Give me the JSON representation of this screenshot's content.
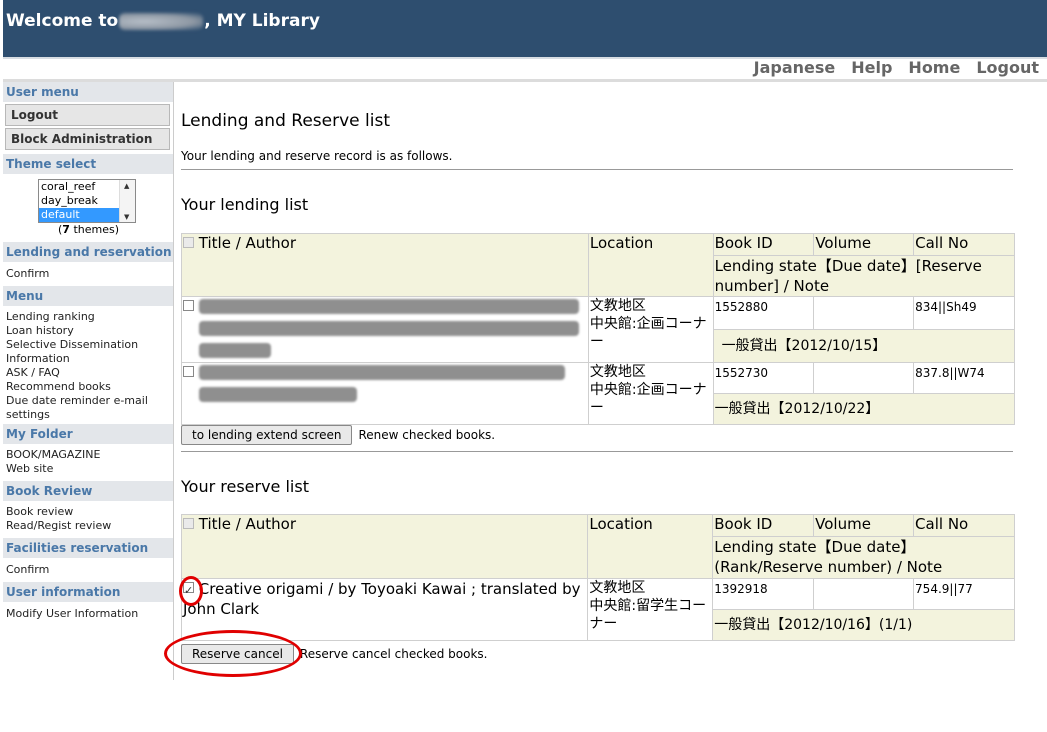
{
  "header": {
    "title_prefix": "Welcome to",
    "title_suffix": ", MY Library"
  },
  "topnav": [
    "Japanese",
    "Help",
    "Home",
    "Logout"
  ],
  "sidebar": {
    "user_menu": "User menu",
    "logout": "Logout",
    "block_admin": "Block Administration",
    "theme_select": "Theme select",
    "themes": [
      "coral_reef",
      "day_break",
      "default"
    ],
    "theme_count_num": "7",
    "theme_count_text": " themes)",
    "lending_reservation": "Lending and reservation",
    "confirm": "Confirm",
    "menu": "Menu",
    "menu_items": [
      "Lending ranking",
      "Loan history",
      "Selective Dissemination Information",
      "ASK / FAQ",
      "Recommend books",
      "Due date reminder e-mail settings"
    ],
    "my_folder": "My Folder",
    "folder_items": [
      "BOOK/MAGAZINE",
      "Web site"
    ],
    "book_review": "Book Review",
    "review_items": [
      "Book review",
      "Read/Regist review"
    ],
    "facilities": "Facilities reservation",
    "facilities_confirm": "Confirm",
    "user_info": "User information",
    "modify_user": "Modify User Information"
  },
  "main": {
    "title": "Lending and Reserve list",
    "intro": "Your lending and reserve record is as follows.",
    "lending_heading": "Your lending list",
    "lending_cols": {
      "title": "Title / Author",
      "location": "Location",
      "bookid": "Book ID",
      "volume": "Volume",
      "callno": "Call No",
      "state": "Lending state【Due date】[Reserve number] / Note"
    },
    "lending_rows": [
      {
        "location": "文教地区\n中央館:企画コーナー",
        "bookid": "1552880",
        "callno": "834||Sh49",
        "state": "一般貸出【2012/10/15】"
      },
      {
        "location": "文教地区\n中央館:企画コーナー",
        "bookid": "1552730",
        "callno": "837.8||W74",
        "state": "一般貸出【2012/10/22】"
      }
    ],
    "extend_button": "to lending extend screen",
    "extend_text": "Renew checked books.",
    "reserve_heading": "Your reserve list",
    "reserve_cols": {
      "title": "Title / Author",
      "location": "Location",
      "bookid": "Book ID",
      "volume": "Volume",
      "callno": "Call No",
      "state": "Lending state【Due date】(Rank/Reserve number) / Note"
    },
    "reserve_rows": [
      {
        "title": "Creative origami / by Toyoaki Kawai ; translated by John Clark",
        "location": "文教地区\n中央館:留学生コーナー",
        "bookid": "1392918",
        "callno": "754.9||77",
        "state": "一般貸出【2012/10/16】(1/1)"
      }
    ],
    "cancel_button": "Reserve cancel",
    "cancel_text": "Reserve cancel checked books."
  },
  "colors": {
    "header_bg": "#2e4e6f",
    "sidebar_heading": "#4a78a8",
    "table_header": "#f3f3dd",
    "highlight": "#e00000"
  }
}
